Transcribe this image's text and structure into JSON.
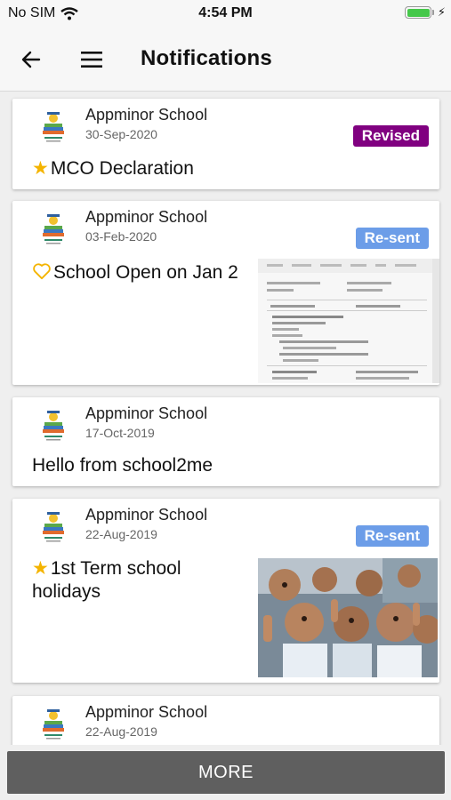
{
  "status_bar": {
    "carrier": "No SIM",
    "time": "4:54 PM"
  },
  "header": {
    "title": "Notifications"
  },
  "notifications": [
    {
      "school": "Appminor School",
      "date": "30-Sep-2020",
      "badge": "Revised",
      "title": "MCO Declaration",
      "icon": "star-icon"
    },
    {
      "school": "Appminor School",
      "date": "03-Feb-2020",
      "badge": "Re-sent",
      "title": "School Open on Jan 2",
      "icon": "heart-outline-icon"
    },
    {
      "school": "Appminor School",
      "date": "17-Oct-2019",
      "badge": "",
      "title": "Hello from school2me",
      "icon": ""
    },
    {
      "school": "Appminor School",
      "date": "22-Aug-2019",
      "badge": "Re-sent",
      "title": "1st Term school holidays",
      "icon": "star-icon"
    },
    {
      "school": "Appminor School",
      "date": "22-Aug-2019",
      "badge": "",
      "title": "",
      "icon": ""
    }
  ],
  "footer": {
    "more_label": "MORE"
  },
  "colors": {
    "revised": "#800080",
    "resent": "#6c9de8",
    "star": "#f4b400",
    "more_bg": "#5f5f5f"
  }
}
